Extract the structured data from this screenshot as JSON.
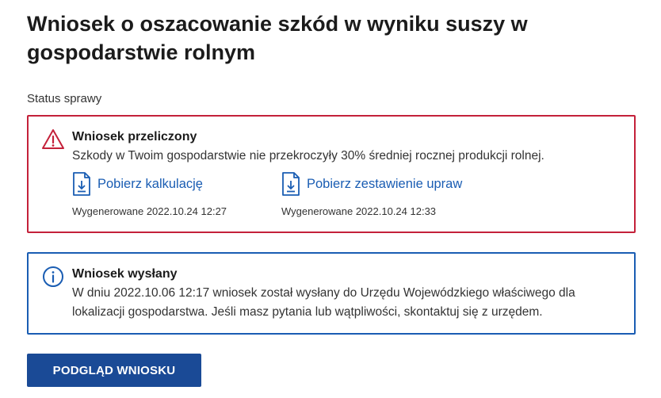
{
  "page": {
    "title": "Wniosek o oszacowanie szkód w wyniku suszy w gospodarstwie rolnym",
    "status_label": "Status sprawy"
  },
  "status_alert": {
    "icon": "warning-triangle-icon",
    "color": "#c4213a",
    "heading": "Wniosek przeliczony",
    "text": "Szkody w Twoim gospodarstwie nie przekroczyły 30% średniej rocznej produkcji rolnej.",
    "downloads": [
      {
        "icon": "file-download-icon",
        "label": "Pobierz kalkulację",
        "generated": "Wygenerowane 2022.10.24 12:27"
      },
      {
        "icon": "file-download-icon",
        "label": "Pobierz zestawienie upraw",
        "generated": "Wygenerowane 2022.10.24 12:33"
      }
    ]
  },
  "info_alert": {
    "icon": "info-circle-icon",
    "color": "#1a5db3",
    "heading": "Wniosek wysłany",
    "text": "W dniu 2022.10.06 12:17 wniosek został wysłany do Urzędu Wojewódzkiego właściwego dla lokalizacji gospodarstwa. Jeśli masz pytania lub wątpliwości, skontaktuj się z urzędem."
  },
  "actions": {
    "preview_label": "PODGLĄD WNIOSKU",
    "primary_color": "#1a4a96"
  }
}
